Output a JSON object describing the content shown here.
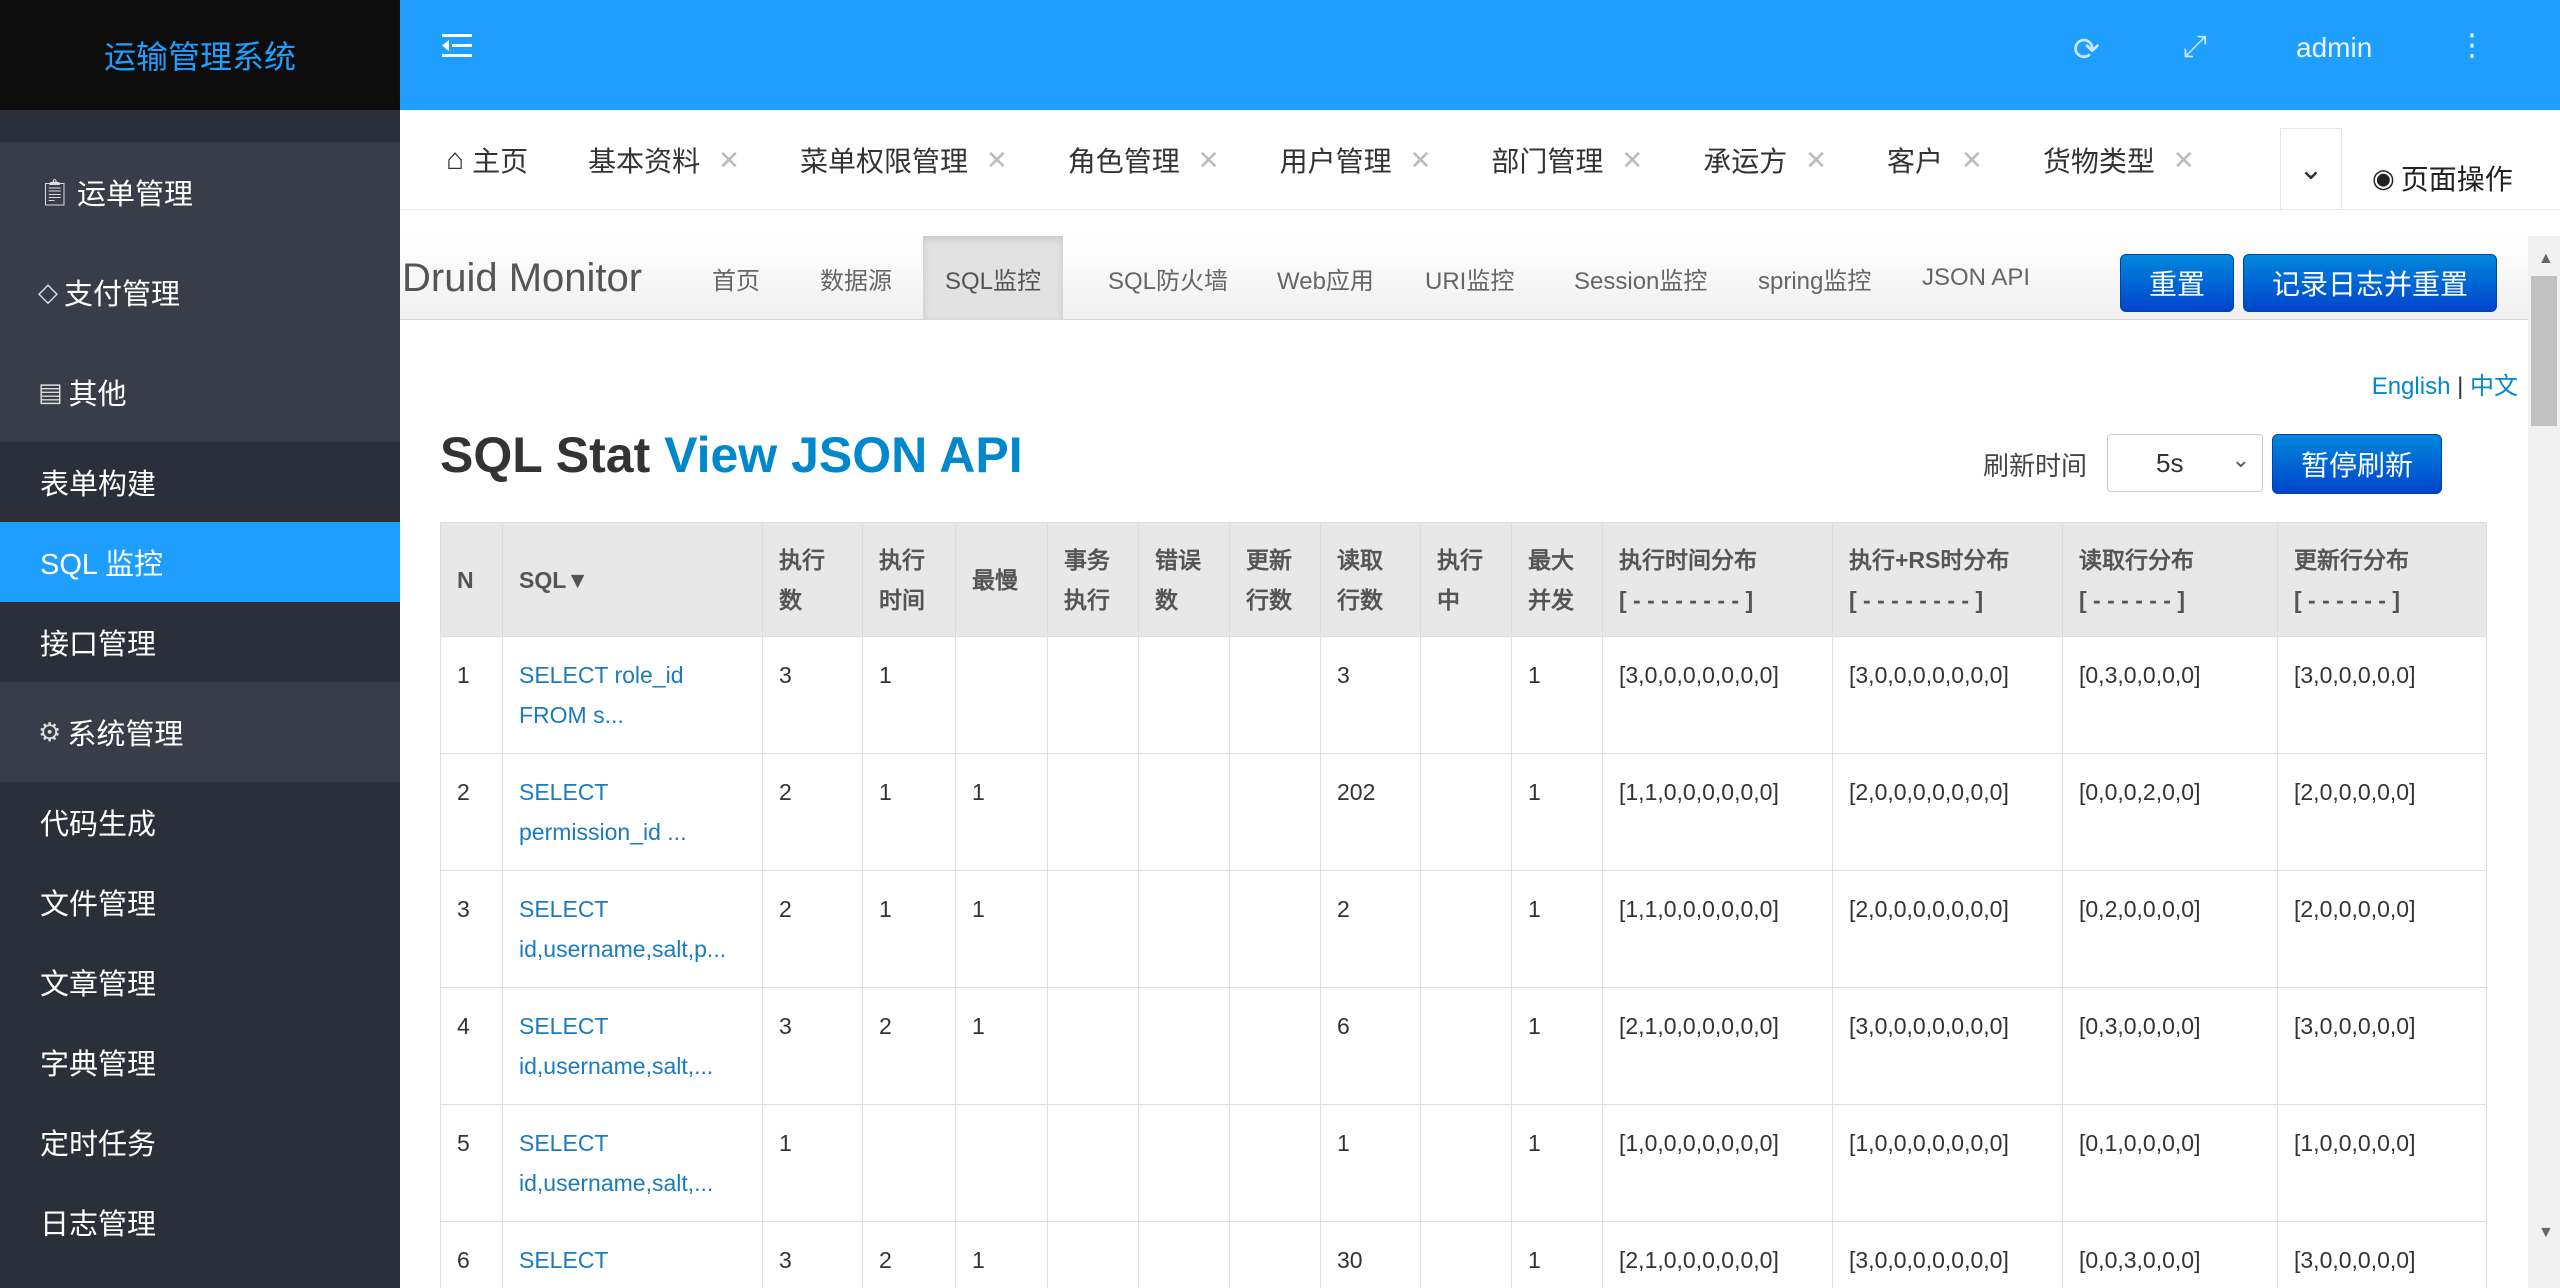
{
  "sidebar": {
    "logo": "运输管理系统",
    "groups": [
      {
        "icon": "📋",
        "label": "运单管理"
      },
      {
        "icon": "💎",
        "label": "支付管理"
      },
      {
        "icon": "📄",
        "label": "其他"
      }
    ],
    "sub_other": [
      "表单构建",
      "SQL 监控",
      "接口管理"
    ],
    "system_group": {
      "icon": "⚙",
      "label": "系统管理"
    },
    "sub_system": [
      "代码生成",
      "文件管理",
      "文章管理",
      "字典管理",
      "定时任务",
      "日志管理"
    ]
  },
  "header": {
    "user": "admin"
  },
  "tabs": [
    {
      "label": "主页",
      "closable": false
    },
    {
      "label": "基本资料",
      "closable": true
    },
    {
      "label": "菜单权限管理",
      "closable": true
    },
    {
      "label": "角色管理",
      "closable": true
    },
    {
      "label": "用户管理",
      "closable": true
    },
    {
      "label": "部门管理",
      "closable": true
    },
    {
      "label": "承运方",
      "closable": true
    },
    {
      "label": "客户",
      "closable": true
    },
    {
      "label": "货物类型",
      "closable": true
    }
  ],
  "page_ops": "页面操作",
  "druid": {
    "brand": "Druid Monitor",
    "nav": [
      "首页",
      "数据源",
      "SQL监控",
      "SQL防火墙",
      "Web应用",
      "URI监控",
      "Session监控",
      "spring监控",
      "JSON API"
    ],
    "active_nav": "SQL监控",
    "reset": "重置",
    "log_reset": "记录日志并重置",
    "lang_en": "English",
    "lang_sep": "|",
    "lang_zh": "中文",
    "title_main": "SQL Stat",
    "title_link": "View JSON API",
    "refresh_label": "刷新时间",
    "refresh_value": "5s",
    "pause": "暂停刷新"
  },
  "table": {
    "headers": [
      [
        "N"
      ],
      [
        "SQL▼"
      ],
      [
        "执行",
        "数"
      ],
      [
        "执行",
        "时间"
      ],
      [
        "最慢"
      ],
      [
        "事务",
        "执行"
      ],
      [
        "错误",
        "数"
      ],
      [
        "更新",
        "行数"
      ],
      [
        "读取",
        "行数"
      ],
      [
        "执行",
        "中"
      ],
      [
        "最大",
        "并发"
      ],
      [
        "执行时间分布",
        "[ - - - - - - - - ]"
      ],
      [
        "执行+RS时分布",
        "[ - - - - - - - - ]"
      ],
      [
        "读取行分布",
        "[ - - - - - - ]"
      ],
      [
        "更新行分布",
        "[ - - - - - - ]"
      ]
    ],
    "rows": [
      [
        "1",
        "SELECT role_id FROM s...",
        "3",
        "1",
        "",
        "",
        "",
        "",
        "3",
        "",
        "1",
        "[3,0,0,0,0,0,0,0]",
        "[3,0,0,0,0,0,0,0]",
        "[0,3,0,0,0,0]",
        "[3,0,0,0,0,0]"
      ],
      [
        "2",
        "SELECT permission_id ...",
        "2",
        "1",
        "1",
        "",
        "",
        "",
        "202",
        "",
        "1",
        "[1,1,0,0,0,0,0,0]",
        "[2,0,0,0,0,0,0,0]",
        "[0,0,0,2,0,0]",
        "[2,0,0,0,0,0]"
      ],
      [
        "3",
        "SELECT id,username,salt,p...",
        "2",
        "1",
        "1",
        "",
        "",
        "",
        "2",
        "",
        "1",
        "[1,1,0,0,0,0,0,0]",
        "[2,0,0,0,0,0,0,0]",
        "[0,2,0,0,0,0]",
        "[2,0,0,0,0,0]"
      ],
      [
        "4",
        "SELECT id,username,salt,...",
        "3",
        "2",
        "1",
        "",
        "",
        "",
        "6",
        "",
        "1",
        "[2,1,0,0,0,0,0,0]",
        "[3,0,0,0,0,0,0,0]",
        "[0,3,0,0,0,0]",
        "[3,0,0,0,0,0]"
      ],
      [
        "5",
        "SELECT id,username,salt,...",
        "1",
        "",
        "",
        "",
        "",
        "",
        "1",
        "",
        "1",
        "[1,0,0,0,0,0,0,0]",
        "[1,0,0,0,0,0,0,0]",
        "[0,1,0,0,0,0]",
        "[1,0,0,0,0,0]"
      ],
      [
        "6",
        "SELECT",
        "3",
        "2",
        "1",
        "",
        "",
        "",
        "30",
        "",
        "1",
        "[2,1,0,0,0,0,0,0]",
        "[3,0,0,0,0,0,0,0]",
        "[0,0,3,0,0,0]",
        "[3,0,0,0,0,0]"
      ]
    ]
  },
  "colors": {
    "accent": "#1e9fff",
    "sidebar_bg": "#2b2f3a",
    "sidebar_group_bg": "#393d49",
    "link": "#0088cc",
    "button": "#0055cc"
  }
}
